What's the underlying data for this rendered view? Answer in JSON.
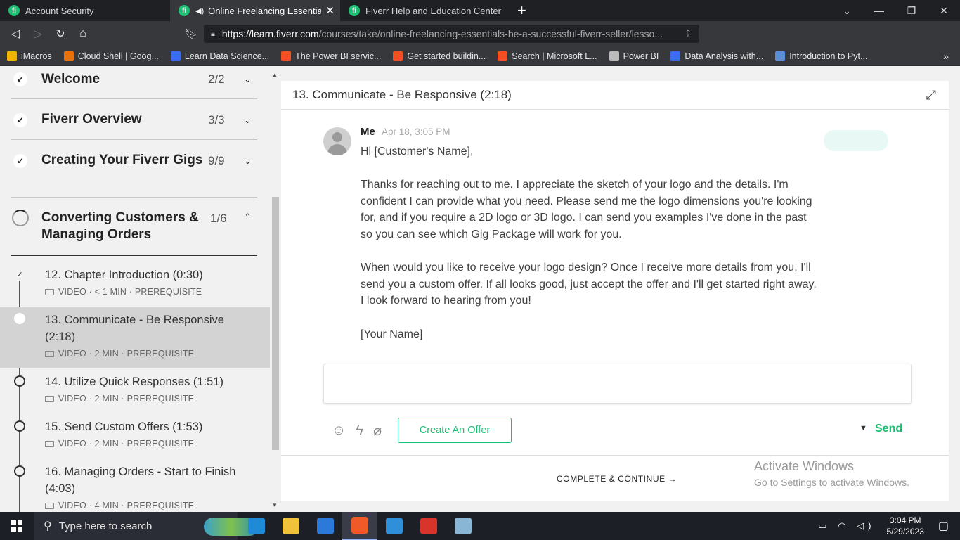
{
  "browser": {
    "tabs": [
      {
        "title": "Account Security",
        "active": false
      },
      {
        "title": "Online Freelancing Essentials: B",
        "active": true
      },
      {
        "title": "Fiverr Help and Education Center",
        "active": false
      }
    ],
    "url_host": "https://learn.fiverr.com",
    "url_path": "/courses/take/online-freelancing-essentials-be-a-successful-fiverr-seller/lesso...",
    "brave_badge": "9",
    "alert_badge": "1",
    "bookmarks": [
      {
        "label": "iMacros",
        "color": "#f0b400"
      },
      {
        "label": "Cloud Shell | Goog...",
        "color": "#e8710a"
      },
      {
        "label": "Learn Data Science...",
        "color": "#3a6cf0"
      },
      {
        "label": "The Power BI servic...",
        "color": "#f25022"
      },
      {
        "label": "Get started buildin...",
        "color": "#f25022"
      },
      {
        "label": "Search | Microsoft L...",
        "color": "#f25022"
      },
      {
        "label": "Power BI",
        "color": "#bbbbbb"
      },
      {
        "label": "Data Analysis with...",
        "color": "#3a6cf0"
      },
      {
        "label": "Introduction to Pyt...",
        "color": "#5a8ed8"
      }
    ]
  },
  "sidebar": {
    "sections": [
      {
        "title": "Welcome",
        "count": "2/2",
        "status": "done"
      },
      {
        "title": "Fiverr Overview",
        "count": "3/3",
        "status": "done"
      },
      {
        "title": "Creating Your Fiverr Gigs",
        "count": "9/9",
        "status": "done"
      },
      {
        "title": "Converting Customers & Managing Orders",
        "count": "1/6",
        "status": "in-progress"
      }
    ],
    "lessons": [
      {
        "title": "12. Chapter Introduction (0:30)",
        "meta": "VIDEO · < 1 MIN · PREREQUISITE",
        "state": "done"
      },
      {
        "title": "13. Communicate - Be Responsive (2:18)",
        "meta": "VIDEO · 2 MIN · PREREQUISITE",
        "state": "current"
      },
      {
        "title": "14. Utilize Quick Responses (1:51)",
        "meta": "VIDEO · 2 MIN · PREREQUISITE",
        "state": "todo"
      },
      {
        "title": "15. Send Custom Offers (1:53)",
        "meta": "VIDEO · 2 MIN · PREREQUISITE",
        "state": "todo"
      },
      {
        "title": "16. Managing Orders - Start to Finish (4:03)",
        "meta": "VIDEO · 4 MIN · PREREQUISITE",
        "state": "todo"
      }
    ]
  },
  "main": {
    "lesson_title": "13. Communicate - Be Responsive (2:18)",
    "message": {
      "sender": "Me",
      "time": "Apr 18, 3:05 PM",
      "greeting": "Hi [Customer's Name],",
      "para1": "Thanks for reaching out to me. I appreciate the sketch of your logo and the details. I'm confident I can provide what you need. Please send me the logo dimensions you're looking for, and if you require a 2D logo or 3D logo. I can send you examples I've done in the past so you can see which Gig Package will work for you.",
      "para2": "When would you like to receive your logo design? Once I receive more details from you, I'll send you a custom offer. If all looks good, just accept the offer and I'll get started right away. I look forward to hearing from you!",
      "signoff": "[Your Name]"
    },
    "offer_button": "Create An Offer",
    "send_label": "Send",
    "continue_label": "COMPLETE & CONTINUE →",
    "watermark_line1": "Activate Windows",
    "watermark_line2": "Go to Settings to activate Windows."
  },
  "taskbar": {
    "search_placeholder": "Type here to search",
    "time": "3:04 PM",
    "date": "5/29/2023",
    "apps": [
      {
        "name": "edge",
        "color": "#1f8ad6"
      },
      {
        "name": "file-explorer",
        "color": "#f0c23a"
      },
      {
        "name": "microsoft-store",
        "color": "#2b79d8"
      },
      {
        "name": "brave",
        "color": "#f05a28"
      },
      {
        "name": "vscode",
        "color": "#2f8fd8"
      },
      {
        "name": "wps-office",
        "color": "#d9342b"
      },
      {
        "name": "notepad",
        "color": "#8ab6d6"
      }
    ]
  }
}
